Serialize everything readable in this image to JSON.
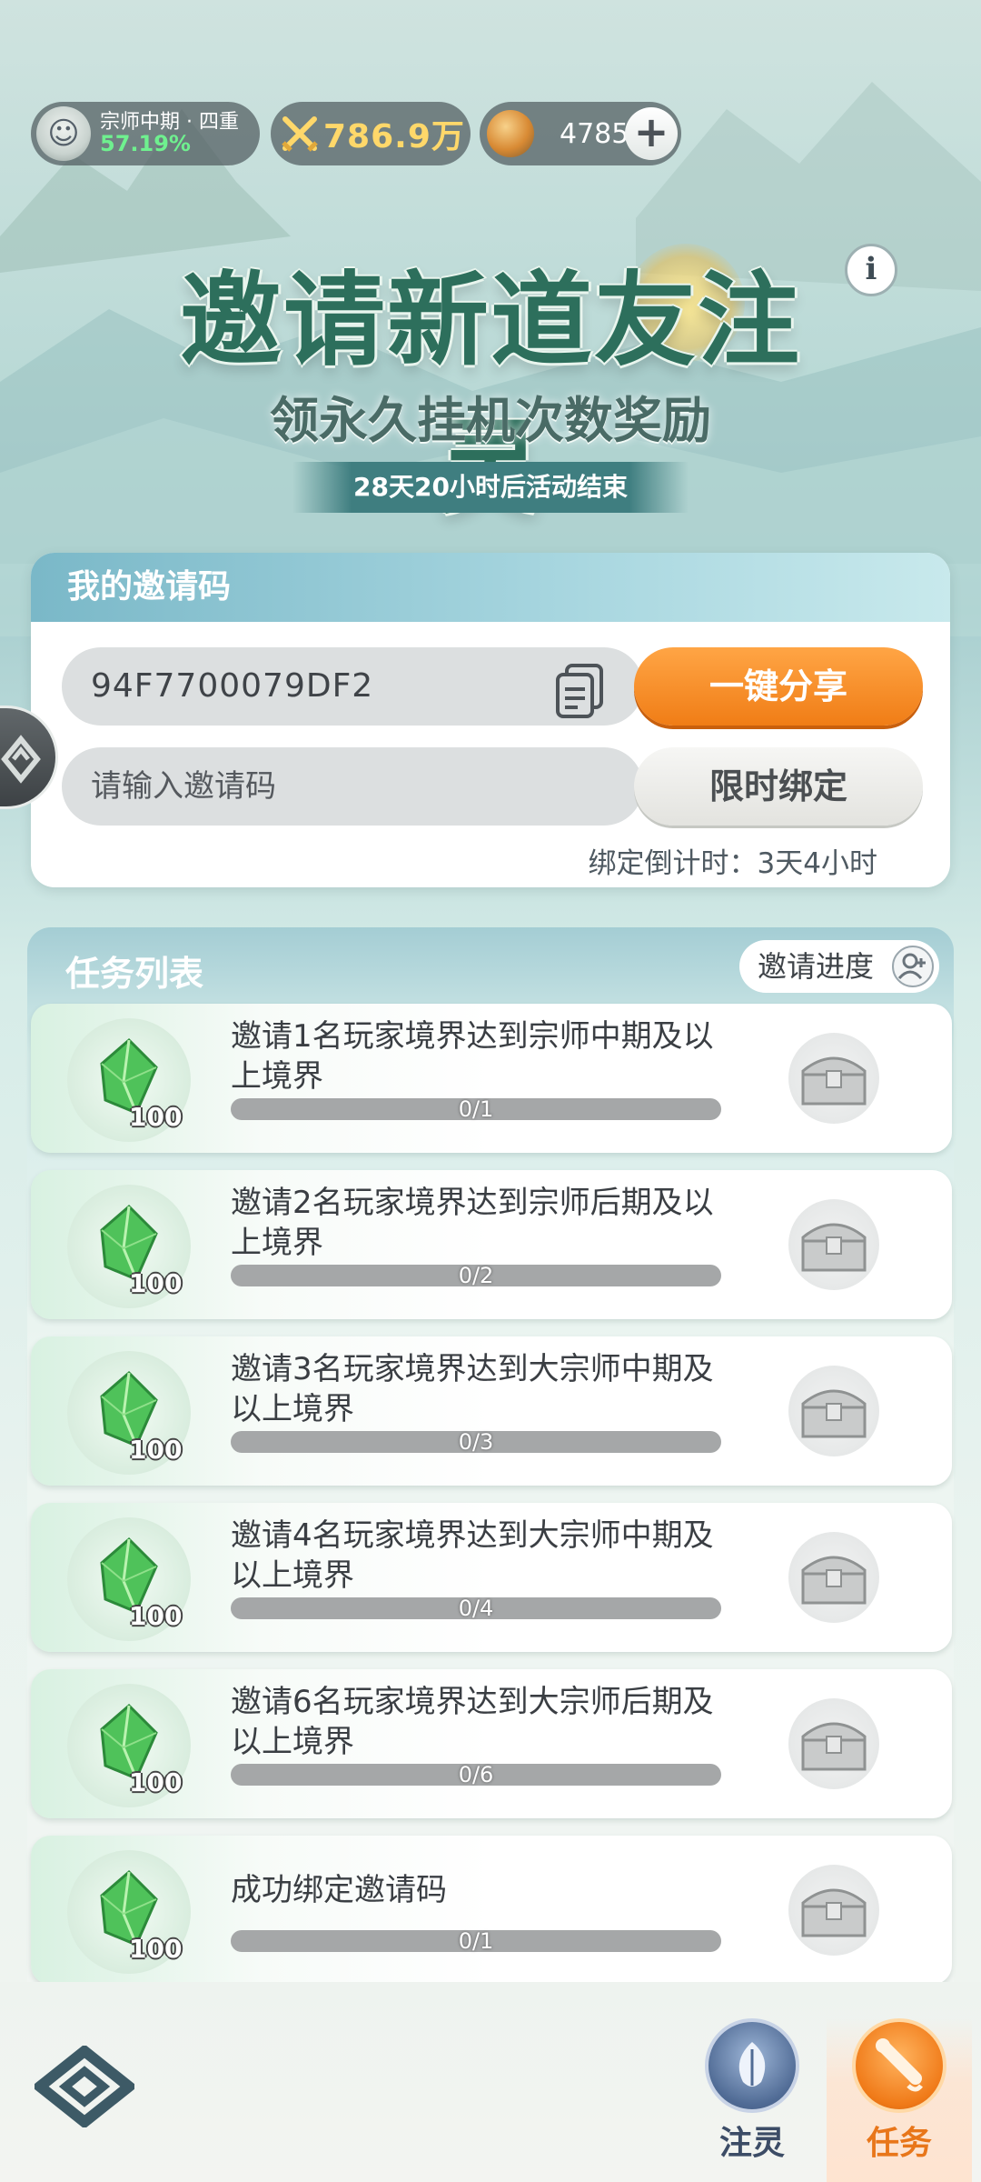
{
  "status_bar": {
    "rank_title": "宗师中期 · 四重",
    "rank_percent": "57.19%",
    "power_value": "786.9万",
    "coin_value": "4785",
    "plus_label": "+"
  },
  "header": {
    "headline": "邀请新道友注灵",
    "subtitle": "领永久挂机次数奖励",
    "timer": "28天20小时后活动结束",
    "info_label": "i"
  },
  "invite_panel": {
    "title": "我的邀请码",
    "my_code": "94F7700079DF2",
    "share_label": "一键分享",
    "input_placeholder": "请输入邀请码",
    "bind_label": "限时绑定",
    "bind_countdown": "绑定倒计时：3天4小时"
  },
  "task_panel": {
    "title": "任务列表",
    "progress_label": "邀请进度",
    "tasks": [
      {
        "desc": "邀请1名玩家境界达到宗师中期及以上境界",
        "reward_qty": "100",
        "progress": "0/1"
      },
      {
        "desc": "邀请2名玩家境界达到宗师后期及以上境界",
        "reward_qty": "100",
        "progress": "0/2"
      },
      {
        "desc": "邀请3名玩家境界达到大宗师中期及以上境界",
        "reward_qty": "100",
        "progress": "0/3"
      },
      {
        "desc": "邀请4名玩家境界达到大宗师中期及以上境界",
        "reward_qty": "100",
        "progress": "0/4"
      },
      {
        "desc": "邀请6名玩家境界达到大宗师后期及以上境界",
        "reward_qty": "100",
        "progress": "0/6"
      },
      {
        "desc": "成功绑定邀请码",
        "reward_qty": "100",
        "progress": "0/1"
      }
    ]
  },
  "bottom_nav": {
    "items": [
      {
        "label": "注灵",
        "icon": "leaf-icon",
        "active": false
      },
      {
        "label": "任务",
        "icon": "scroll-icon",
        "active": true
      }
    ]
  },
  "colors": {
    "accent_orange": "#f07d16",
    "headline_green": "#2d6f5c",
    "panel_header_blue": "#7ab8c8"
  }
}
